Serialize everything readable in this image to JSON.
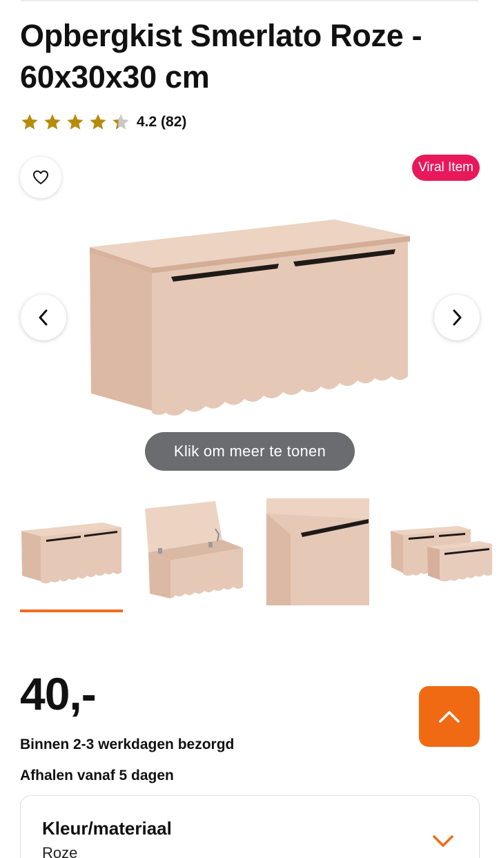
{
  "product": {
    "title": "Opbergkist Smerlato Roze - 60x30x30 cm",
    "rating_value": 4.2,
    "rating_text": "4.2 (82)",
    "badge": "Viral Item",
    "more_label": "Klik om meer te tonen"
  },
  "icons": {
    "favorite": "heart-icon",
    "prev": "chevron-left-icon",
    "next": "chevron-right-icon",
    "back_to_top": "chevron-up-icon",
    "expand": "chevron-down-icon",
    "rating": "star-icon"
  },
  "thumbnails": [
    {
      "alt": "front view",
      "active": true
    },
    {
      "alt": "open lid view",
      "active": false
    },
    {
      "alt": "close-up view",
      "active": false
    },
    {
      "alt": "two chests view",
      "active": false
    }
  ],
  "pricing": {
    "price": "40,-",
    "delivery": "Binnen 2-3 werkdagen bezorgd",
    "pickup": "Afhalen vanaf 5 dagen"
  },
  "options": {
    "title": "Kleur/materiaal",
    "value": "Roze"
  },
  "colors": {
    "accent_orange": "#f06a13",
    "badge_pink": "#e8195a",
    "star_gold": "#b88a0a",
    "star_empty": "#c8c8c8",
    "product_pink": "#e6c8b6"
  }
}
